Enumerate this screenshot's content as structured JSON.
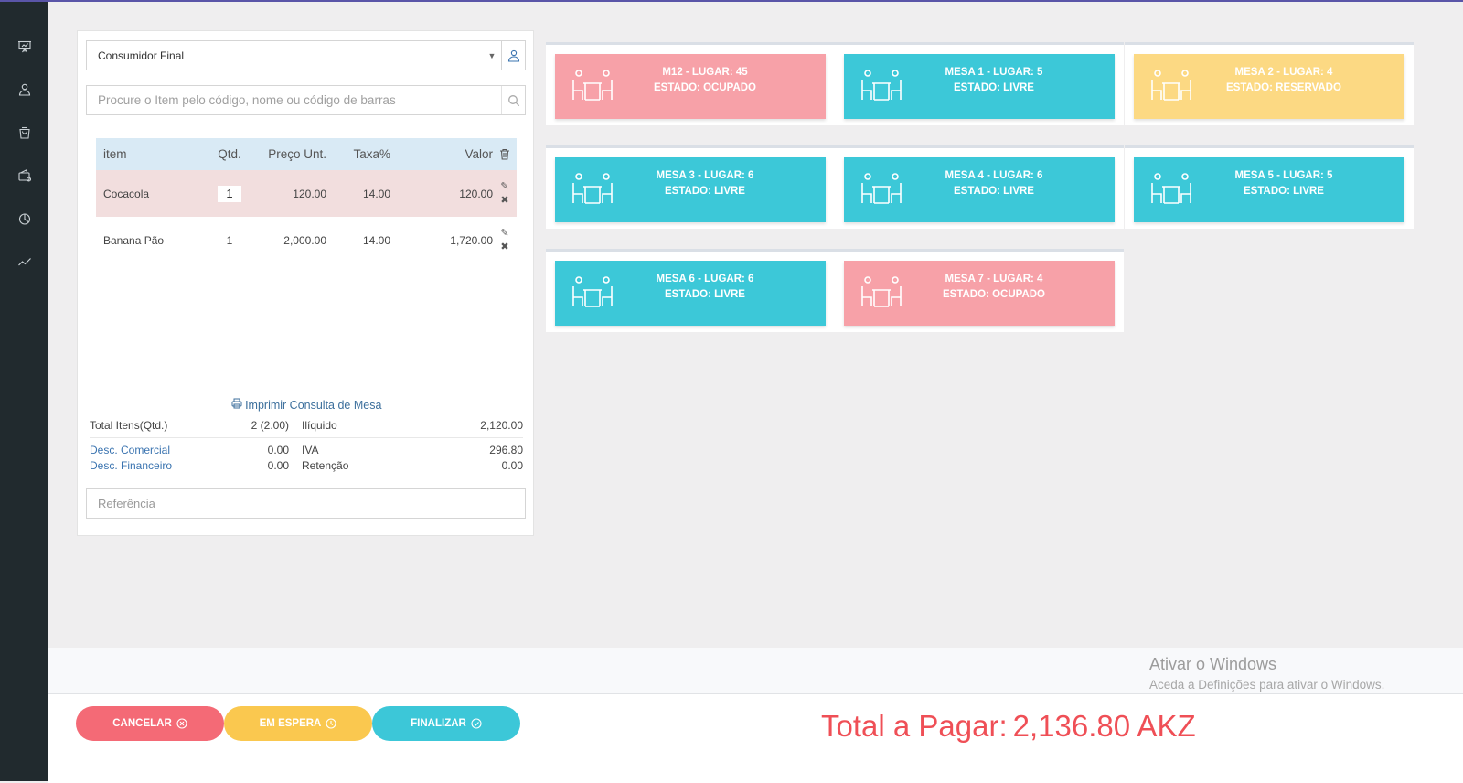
{
  "sidebar": {
    "items": [
      {
        "icon": "presentation-icon"
      },
      {
        "icon": "users-icon"
      },
      {
        "icon": "shopping-bag-icon"
      },
      {
        "icon": "wallet-icon"
      },
      {
        "icon": "pie-chart-icon"
      },
      {
        "icon": "trend-line-icon"
      }
    ]
  },
  "order": {
    "customer": "Consumidor Final",
    "search_placeholder": "Procure o Item pelo código, nome ou código de barras",
    "columns": {
      "item": "item",
      "qty": "Qtd.",
      "price": "Preço Unt.",
      "tax": "Taxa%",
      "value": "Valor"
    },
    "rows": [
      {
        "item": "Cocacola",
        "qty": "1",
        "price": "120.00",
        "tax": "14.00",
        "value": "120.00"
      },
      {
        "item": "Banana Pão",
        "qty": "1",
        "price": "2,000.00",
        "tax": "14.00",
        "value": "1,720.00"
      }
    ],
    "print_link": "Imprimir Consulta de Mesa",
    "totals": {
      "total_items_label": "Total Itens(Qtd.)",
      "total_items_value": "2 (2.00)",
      "iliquido_label": "Ilíquido",
      "iliquido_value": "2,120.00",
      "desc_comercial_label": "Desc. Comercial",
      "desc_comercial_value": "0.00",
      "iva_label": "IVA",
      "iva_value": "296.80",
      "desc_financeiro_label": "Desc. Financeiro",
      "desc_financeiro_value": "0.00",
      "retencao_label": "Retenção",
      "retencao_value": "0.00"
    },
    "reference_placeholder": "Referência"
  },
  "tables": [
    {
      "name": "M12 - LUGAR: 45",
      "state": "ESTADO: OCUPADO",
      "status": "ocupado"
    },
    {
      "name": "MESA 1 - LUGAR: 5",
      "state": "ESTADO: LIVRE",
      "status": "livre"
    },
    {
      "name": "MESA 2 - LUGAR: 4",
      "state": "ESTADO: RESERVADO",
      "status": "reservado"
    },
    {
      "name": "MESA 3 - LUGAR: 6",
      "state": "ESTADO: LIVRE",
      "status": "livre"
    },
    {
      "name": "MESA 4 - LUGAR: 6",
      "state": "ESTADO: LIVRE",
      "status": "livre"
    },
    {
      "name": "MESA 5 - LUGAR: 5",
      "state": "ESTADO: LIVRE",
      "status": "livre"
    },
    {
      "name": "MESA 6 - LUGAR: 6",
      "state": "ESTADO: LIVRE",
      "status": "livre"
    },
    {
      "name": "MESA 7 - LUGAR: 4",
      "state": "ESTADO: OCUPADO",
      "status": "ocupado"
    }
  ],
  "status_colors": {
    "livre": "#3cc8d8",
    "ocupado": "#f7a1a8",
    "reservado": "#fcd983"
  },
  "watermark": {
    "title": "Ativar o Windows",
    "subtitle": "Aceda a Definições para ativar o Windows."
  },
  "footer": {
    "cancel_label": "CANCELAR",
    "wait_label": "EM ESPERA",
    "finish_label": "FINALIZAR",
    "total_label": "Total a Pagar:",
    "total_value": "2,136.80 AKZ"
  }
}
